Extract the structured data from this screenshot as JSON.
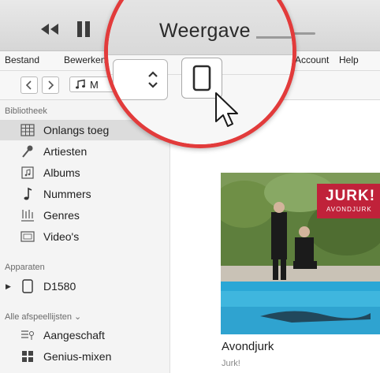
{
  "toolbar": {
    "title": "Weergave",
    "controls": {
      "previous_icon": "rewind-icon",
      "pause_icon": "pause-icon",
      "next_icon": "fast-forward-icon"
    }
  },
  "menubar": {
    "items": [
      "Bestand",
      "Bewerken",
      "Account",
      "Help"
    ]
  },
  "navigation": {
    "back_icon": "chevron-left-icon",
    "forward_icon": "chevron-right-icon",
    "media_select_label": "M",
    "media_select_icon": "music-note-icon"
  },
  "zoom": {
    "selector_icon": "up-down-chevrons-icon",
    "device_button_icon": "device-icon",
    "cursor_icon": "mouse-pointer-icon",
    "highlight_color": "#e23b3b"
  },
  "sidebar": {
    "library_heading": "Bibliotheek",
    "library_items": [
      {
        "label": "Onlangs toeg",
        "icon": "grid-icon"
      },
      {
        "label": "Artiesten",
        "icon": "microphone-icon"
      },
      {
        "label": "Albums",
        "icon": "album-icon"
      },
      {
        "label": "Nummers",
        "icon": "music-note-icon"
      },
      {
        "label": "Genres",
        "icon": "genres-icon"
      },
      {
        "label": "Video's",
        "icon": "video-icon"
      }
    ],
    "devices_heading": "Apparaten",
    "devices": [
      {
        "label": "D1580",
        "icon": "device-icon"
      }
    ],
    "playlists_heading": "Alle afspeellijsten ⌄",
    "playlists": [
      {
        "label": "Aangeschaft",
        "icon": "purchased-list-icon"
      },
      {
        "label": "Genius-mixen",
        "icon": "genius-grid-icon"
      }
    ]
  },
  "album": {
    "title": "Avondjurk",
    "artist": "Jurk!",
    "cover_logo": "JURK!",
    "cover_subtitle": "AVONDJURK"
  }
}
